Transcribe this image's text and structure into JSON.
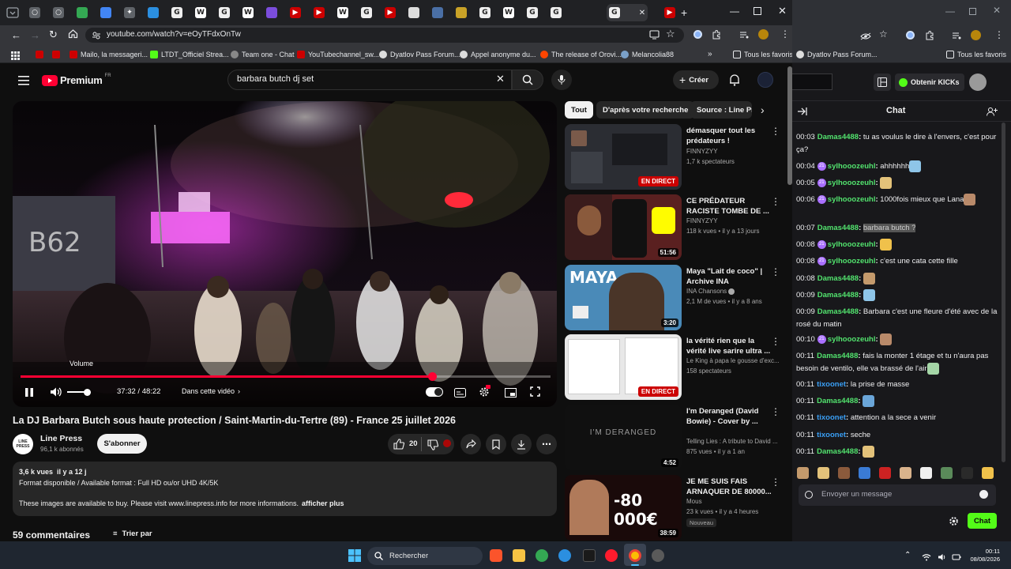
{
  "browser": {
    "url": "youtube.com/watch?v=eOyTFdxOnTw",
    "bookmarks": [
      "Mailo, la messageri...",
      "LTDT_Officiel Strea...",
      "Team one - Chat",
      "YouTubechannel_sw...",
      "Dyatlov Pass Forum...",
      "Appel anonyme du...",
      "The release of Orovi...",
      "Melancolia88"
    ],
    "bookmarks_folder": "Tous les favoris",
    "right_bookmark": "Dyatlov Pass Forum...",
    "right_folder": "Tous les favoris"
  },
  "youtube": {
    "logo": "Premium",
    "logo_region": "FR",
    "search_query": "barbara butch dj set",
    "create_label": "Créer",
    "video": {
      "time": "37:32 / 48:22",
      "chapter": "Dans cette vidéo",
      "volume_tooltip": "Volume",
      "progress": 0.776,
      "wall_tag": "B62"
    },
    "title": "La DJ Barbara Butch sous haute protection / Saint-Martin-du-Tertre (89) - France 25 juillet 2026",
    "channel": {
      "name": "Line Press",
      "subs": "96,1 k abonnés",
      "avatar_text": "LINE PRESS"
    },
    "subscribe": "S'abonner",
    "likes": "20",
    "description": {
      "stats": "3,6 k vues  il y a 12 j",
      "line1": "Format disponible / Available format : Full HD ou/or UHD 4K/5K",
      "line2": "These images are available to buy. Please visit www.linepress.info for more informations.",
      "more": "afficher plus"
    },
    "comments_count": "59 commentaires",
    "sort": "Trier par",
    "chips": [
      "Tout",
      "D'après votre recherche",
      "Source : Line Pr"
    ],
    "recommendations": [
      {
        "title": "démasquer tout les prédateurs !",
        "channel": "FINNYZYY",
        "meta": "1,7 k spectateurs",
        "badge": "EN DIRECT"
      },
      {
        "title": "CE PRÉDATEUR RACISTE TOMBE DE ...",
        "channel": "FINNYZYY",
        "meta": "118 k vues • il y a 13 jours",
        "badge": "51:56"
      },
      {
        "title": "Maya \"Lait de coco\" | Archive INA",
        "channel": "INA Chansons",
        "meta": "2,1 M de vues • il y a 8 ans",
        "badge": "3:20",
        "thumb_text": "MAYA"
      },
      {
        "title": "la vérité rien que la vérité live sarire ultra ...",
        "channel": "Le King à papa le gousse d'exc...",
        "meta": "158 spectateurs",
        "badge": "EN DIRECT"
      },
      {
        "title": "I'm Deranged (David Bowie) - Cover by ...",
        "channel": "Telling Lies : A tribute to David ...",
        "meta": "875 vues • il y a 1 an",
        "badge": "4:52",
        "thumb_text": "I'M DERANGED"
      },
      {
        "title": "JE ME SUIS FAIS ARNAQUER DE 80000...",
        "channel": "Mous",
        "meta": "23 k vues • il y a 4 heures",
        "badge": "38:59",
        "tag": "Nouveau",
        "thumb_text": "-80 000€"
      }
    ]
  },
  "kick": {
    "kicks_button": "Obtenir KICKs",
    "chat_title": "Chat",
    "messages": [
      {
        "time": "00:03",
        "user": "Damas4488",
        "color": "#52e36e",
        "text": "tu as voulus le dire à l'envers, c'est pour ça?"
      },
      {
        "time": "00:04",
        "user": "sylhooozeuhl",
        "color": "#52e36e",
        "badge": "21",
        "text": "ahhhhhh"
      },
      {
        "time": "00:05",
        "user": "sylhooozeuhl",
        "color": "#52e36e",
        "badge": "21",
        "text": ""
      },
      {
        "time": "00:06",
        "user": "sylhooozeuhl",
        "color": "#52e36e",
        "badge": "21",
        "text": "1000fois mieux que Lana"
      },
      {
        "time": "00:07",
        "user": "Damas4488",
        "color": "#52e36e",
        "text": "barbara butch ?"
      },
      {
        "time": "00:08",
        "user": "sylhooozeuhl",
        "color": "#52e36e",
        "badge": "21",
        "text": ""
      },
      {
        "time": "00:08",
        "user": "sylhooozeuhl",
        "color": "#52e36e",
        "badge": "21",
        "text": "c'est une cata cette fille"
      },
      {
        "time": "00:08",
        "user": "Damas4488",
        "color": "#52e36e",
        "text": ""
      },
      {
        "time": "00:09",
        "user": "Damas4488",
        "color": "#52e36e",
        "text": ""
      },
      {
        "time": "00:09",
        "user": "Damas4488",
        "color": "#52e36e",
        "text": "Barbara c'est une fleure d'été avec de la rosé du matin"
      },
      {
        "time": "00:10",
        "user": "sylhooozeuhl",
        "color": "#52e36e",
        "badge": "21",
        "text": ""
      },
      {
        "time": "00:11",
        "user": "Damas4488",
        "color": "#52e36e",
        "text": "fais la monter 1 étage et tu n'aura pas besoin de ventilo, elle va brassé de l'air"
      },
      {
        "time": "00:11",
        "user": "tixoonet",
        "color": "#3a9ff5",
        "text": "la prise de masse"
      },
      {
        "time": "00:11",
        "user": "Damas4488",
        "color": "#52e36e",
        "text": ""
      },
      {
        "time": "00:11",
        "user": "tixoonet",
        "color": "#3a9ff5",
        "text": "attention a la sece a venir"
      },
      {
        "time": "00:11",
        "user": "tixoonet",
        "color": "#3a9ff5",
        "text": "seche"
      },
      {
        "time": "00:11",
        "user": "Damas4488",
        "color": "#52e36e",
        "text": ""
      }
    ],
    "input_placeholder": "Envoyer un message",
    "send_label": "Chat"
  },
  "taskbar": {
    "search": "Rechercher",
    "time": "00:11",
    "date": "08/08/2026"
  },
  "colors": {
    "accent_red": "#ff0033",
    "kick_green": "#53fc18",
    "twitch_purple": "#a970ff"
  }
}
